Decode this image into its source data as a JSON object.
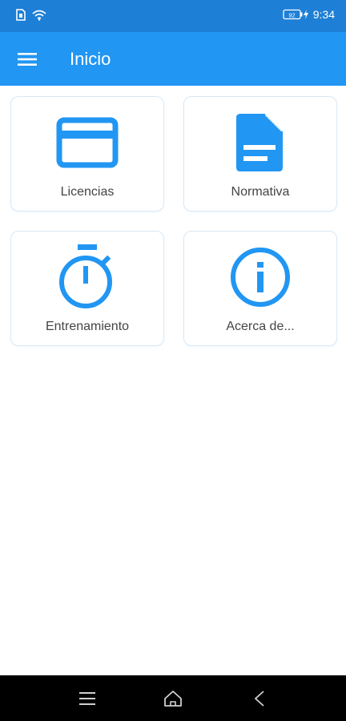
{
  "status_bar": {
    "time": "9:34",
    "battery_level": "92",
    "icons": [
      "sim-icon",
      "wifi-icon",
      "battery-icon"
    ]
  },
  "app_bar": {
    "title": "Inicio",
    "menu_icon": "menu-icon"
  },
  "cards": [
    {
      "label": "Licencias",
      "icon": "card-icon"
    },
    {
      "label": "Normativa",
      "icon": "document-icon"
    },
    {
      "label": "Entrenamiento",
      "icon": "stopwatch-icon"
    },
    {
      "label": "Acerca de...",
      "icon": "info-icon"
    }
  ],
  "nav_bar": {
    "icons": [
      "recent-apps-icon",
      "home-icon",
      "back-icon"
    ]
  },
  "colors": {
    "primary": "#2196f3",
    "status_bar": "#1e7fd6",
    "label_text": "#444444"
  }
}
